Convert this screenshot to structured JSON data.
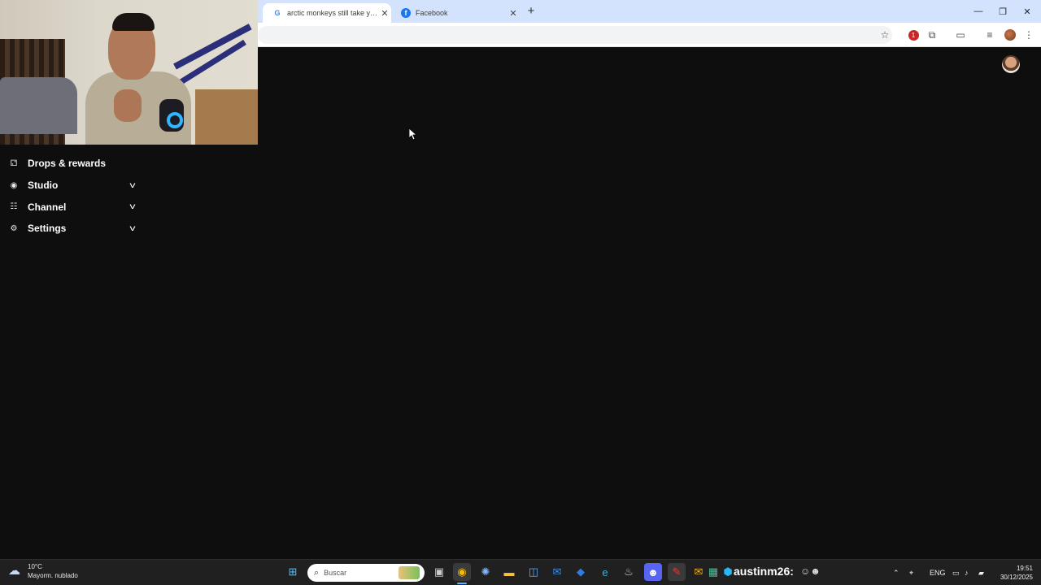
{
  "browser": {
    "tabs": [
      {
        "title": "arctic monkeys still take you ho",
        "favicon": "google-icon",
        "active": true
      },
      {
        "title": "Facebook",
        "favicon": "facebook-icon",
        "active": false
      }
    ],
    "new_tab_symbol": "+",
    "close_symbol": "✕",
    "window_controls": {
      "minimize": "—",
      "restore": "❐",
      "close": "✕"
    },
    "extension_badge": "1",
    "accent": "#d3e3fd"
  },
  "menu": {
    "items": [
      {
        "label": "Drops & rewards",
        "icon": "drops-icon",
        "has_chevron": false
      },
      {
        "label": "Studio",
        "icon": "studio-icon",
        "has_chevron": true
      },
      {
        "label": "Channel",
        "icon": "channel-icon",
        "has_chevron": true
      },
      {
        "label": "Settings",
        "icon": "settings-icon",
        "has_chevron": true
      }
    ]
  },
  "taskbar": {
    "weather": {
      "temp": "10°C",
      "condition": "Mayorm. nublado"
    },
    "search_placeholder": "Buscar",
    "stream_title": "austinm26:",
    "language": "ENG",
    "time": "19:51",
    "date": "30/12/2025"
  }
}
